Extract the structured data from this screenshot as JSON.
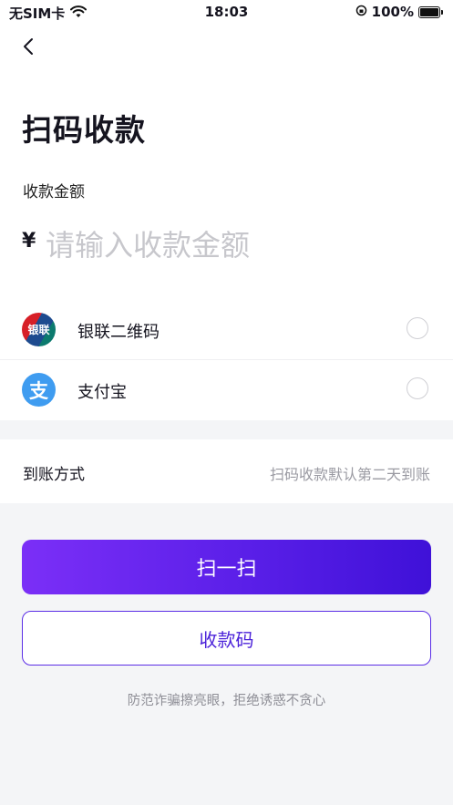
{
  "status_bar": {
    "carrier": "无SIM卡",
    "time": "18:03",
    "battery": "100%"
  },
  "header": {
    "title": "扫码收款"
  },
  "amount": {
    "label": "收款金额",
    "currency_symbol": "¥",
    "placeholder": "请输入收款金额",
    "value": ""
  },
  "payment_methods": [
    {
      "name": "银联二维码",
      "icon": "unionpay-icon",
      "icon_text": "银联",
      "selected": false
    },
    {
      "name": "支付宝",
      "icon": "alipay-icon",
      "icon_text": "支",
      "selected": false
    }
  ],
  "settlement": {
    "label": "到账方式",
    "value": "扫码收款默认第二天到账"
  },
  "actions": {
    "scan_label": "扫一扫",
    "qr_label": "收款码"
  },
  "footer": {
    "note": "防范诈骗擦亮眼，拒绝诱惑不贪心"
  },
  "colors": {
    "accent": "#5a1fe8",
    "alipay": "#3f9cf0"
  }
}
